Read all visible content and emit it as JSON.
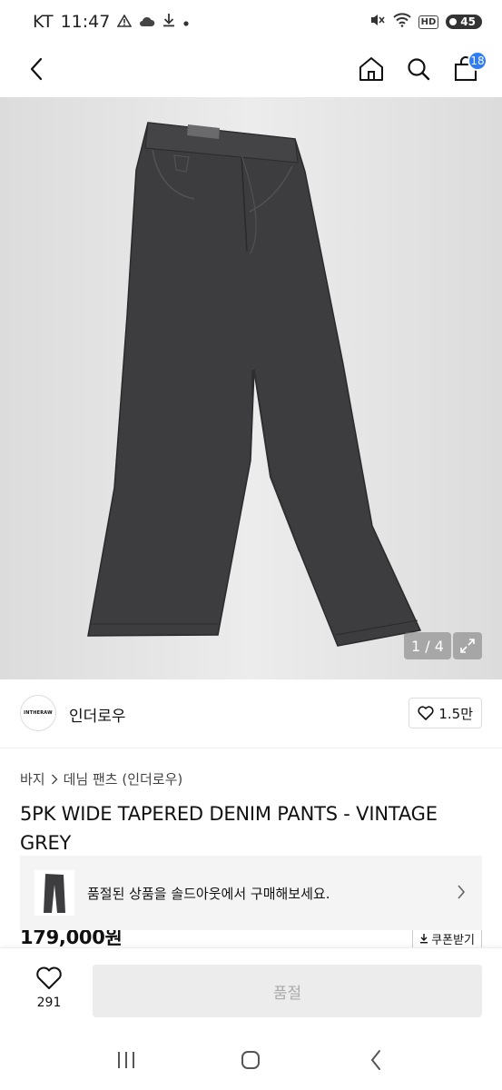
{
  "status_bar": {
    "carrier": "KT",
    "time": "11:47",
    "hd": "HD",
    "battery": "45",
    "icons": [
      "warning-icon",
      "cloud-icon",
      "download-icon",
      "dot-icon",
      "mute-icon",
      "wifi-icon",
      "hd-icon",
      "battery-icon"
    ]
  },
  "top_nav": {
    "cart_count": "18",
    "icons": [
      "back-icon",
      "home-icon",
      "search-icon",
      "cart-icon"
    ]
  },
  "gallery": {
    "counter": "1 / 4",
    "background": "#e8e8e8",
    "product_color": "#3d3d3f"
  },
  "brand": {
    "logo_text": "INTHERAW",
    "name": "인더로우",
    "likes": "1.5만"
  },
  "breadcrumb": {
    "items": [
      "바지",
      "데님 팬츠 (인더로우)"
    ]
  },
  "product": {
    "title": "5PK WIDE TAPERED DENIM PANTS - VINTAGE GREY",
    "price": "179,000원",
    "coupon_label": "쿠폰받기"
  },
  "soldout_banner": {
    "text": "품절된 상품을 솔드아웃에서 구매해보세요."
  },
  "purchase_bar": {
    "wish_count": "291",
    "button_label": "품절"
  },
  "colors": {
    "accent": "#2e7cf6",
    "banner_bg": "#f4f4f4",
    "disabled_btn": "#ececec"
  }
}
